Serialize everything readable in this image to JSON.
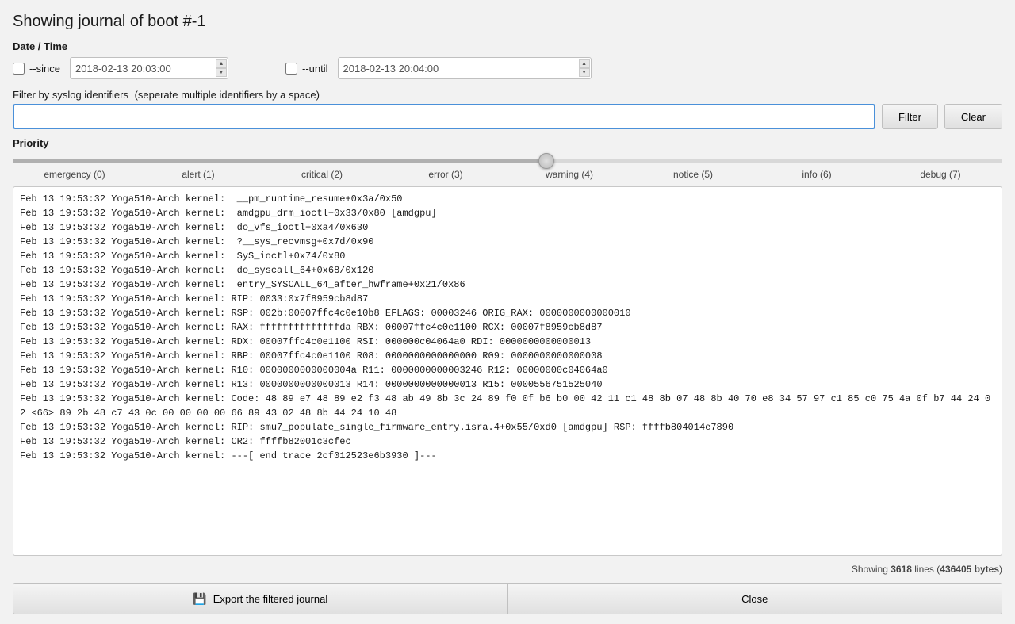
{
  "page": {
    "title": "Showing journal of boot #-1"
  },
  "datetime_section": {
    "label": "Date / Time",
    "since": {
      "checkbox_checked": false,
      "label": "--since",
      "value": "2018-02-13 20:03:00"
    },
    "until": {
      "checkbox_checked": false,
      "label": "--until",
      "value": "2018-02-13 20:04:00"
    }
  },
  "filter_section": {
    "label": "Filter by syslog identifiers",
    "sublabel": "(seperate multiple identifiers by a space)",
    "input_value": "",
    "input_placeholder": "",
    "filter_button_label": "Filter",
    "clear_button_label": "Clear"
  },
  "priority_section": {
    "label": "Priority",
    "slider_value": 54,
    "ticks": [
      "emergency (0)",
      "alert (1)",
      "critical (2)",
      "error (3)",
      "warning (4)",
      "notice (5)",
      "info (6)",
      "debug (7)"
    ]
  },
  "log": {
    "lines": [
      "Feb 13 19:53:32 Yoga510-Arch kernel:  __pm_runtime_resume+0x3a/0x50",
      "Feb 13 19:53:32 Yoga510-Arch kernel:  amdgpu_drm_ioctl+0x33/0x80 [amdgpu]",
      "Feb 13 19:53:32 Yoga510-Arch kernel:  do_vfs_ioctl+0xa4/0x630",
      "Feb 13 19:53:32 Yoga510-Arch kernel:  ?__sys_recvmsg+0x7d/0x90",
      "Feb 13 19:53:32 Yoga510-Arch kernel:  SyS_ioctl+0x74/0x80",
      "Feb 13 19:53:32 Yoga510-Arch kernel:  do_syscall_64+0x68/0x120",
      "Feb 13 19:53:32 Yoga510-Arch kernel:  entry_SYSCALL_64_after_hwframe+0x21/0x86",
      "Feb 13 19:53:32 Yoga510-Arch kernel: RIP: 0033:0x7f8959cb8d87",
      "Feb 13 19:53:32 Yoga510-Arch kernel: RSP: 002b:00007ffc4c0e10b8 EFLAGS: 00003246 ORIG_RAX: 0000000000000010",
      "Feb 13 19:53:32 Yoga510-Arch kernel: RAX: ffffffffffffffda RBX: 00007ffc4c0e1100 RCX: 00007f8959cb8d87",
      "Feb 13 19:53:32 Yoga510-Arch kernel: RDX: 00007ffc4c0e1100 RSI: 000000c04064a0 RDI: 0000000000000013",
      "Feb 13 19:53:32 Yoga510-Arch kernel: RBP: 00007ffc4c0e1100 R08: 0000000000000000 R09: 0000000000000008",
      "Feb 13 19:53:32 Yoga510-Arch kernel: R10: 0000000000000004a R11: 0000000000003246 R12: 00000000c04064a0",
      "Feb 13 19:53:32 Yoga510-Arch kernel: R13: 0000000000000013 R14: 0000000000000013 R15: 0000556751525040",
      "Feb 13 19:53:32 Yoga510-Arch kernel: Code: 48 89 e7 48 89 e2 f3 48 ab 49 8b 3c 24 89 f0 0f b6 b0 00 42 11 c1 48 8b 07 48 8b 40 70 e8 34 57 97 c1 85 c0 75 4a 0f b7 44 24 02 <66> 89 2b 48 c7 43 0c 00 00 00 00 66 89 43 02 48 8b 44 24 10 48",
      "Feb 13 19:53:32 Yoga510-Arch kernel: RIP: smu7_populate_single_firmware_entry.isra.4+0x55/0xd0 [amdgpu] RSP: ffffb804014e7890",
      "Feb 13 19:53:32 Yoga510-Arch kernel: CR2: ffffb82001c3cfec",
      "Feb 13 19:53:32 Yoga510-Arch kernel: ---[ end trace 2cf012523e6b3930 ]---"
    ],
    "status": "Showing ",
    "line_count": "3618",
    "status_mid": " lines (",
    "byte_count": "436405 bytes",
    "status_end": ")"
  },
  "bottom_buttons": {
    "export_label": "Export the filtered journal",
    "close_label": "Close",
    "floppy_icon": "💾"
  }
}
